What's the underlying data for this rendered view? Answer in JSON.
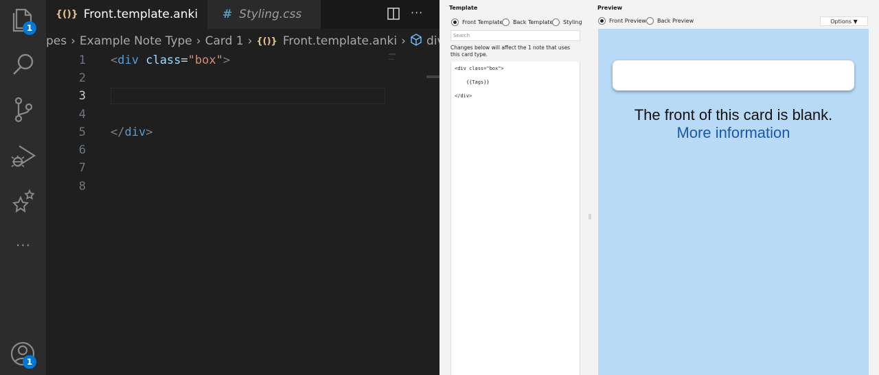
{
  "activity_bar": {
    "explorer_badge": "1",
    "accounts_badge": "1",
    "more_label": "···"
  },
  "editor": {
    "tabs": [
      {
        "icon": "{()}",
        "label": "Front.template.anki",
        "active": true
      },
      {
        "icon": "#",
        "label": "Styling.css",
        "active": false
      }
    ],
    "breadcrumb": [
      "pes",
      "Example Note Type",
      "Card 1",
      "Front.template.anki",
      "div.bc"
    ],
    "breadcrumb_icon": "{()}",
    "line_numbers": [
      "1",
      "2",
      "3",
      "4",
      "5",
      "6",
      "7",
      "8"
    ],
    "lines": {
      "l1_open": "<",
      "l1_tag": "div",
      "l1_attr": "class",
      "l1_eq": "=",
      "l1_str": "\"box\"",
      "l1_close": ">",
      "l5_open": "</",
      "l5_tag": "div",
      "l5_close": ">"
    }
  },
  "template_panel": {
    "title": "Template",
    "radios": [
      "Front Template",
      "Back Template",
      "Styling"
    ],
    "search_placeholder": "Search",
    "notice": "Changes below will affect the 1 note that uses this card type.",
    "code_lines": [
      "<div class=\"box\">",
      "    {{Tags}}",
      "</div>"
    ]
  },
  "preview_panel": {
    "title": "Preview",
    "radios": [
      "Front Preview",
      "Back Preview"
    ],
    "options_label": "Options ▼",
    "blank_message": "The front of this card is blank.",
    "more_info": "More information"
  },
  "colors": {
    "accent": "#0078d4",
    "preview_bg": "#b8daf6",
    "link": "#1a55b0"
  }
}
